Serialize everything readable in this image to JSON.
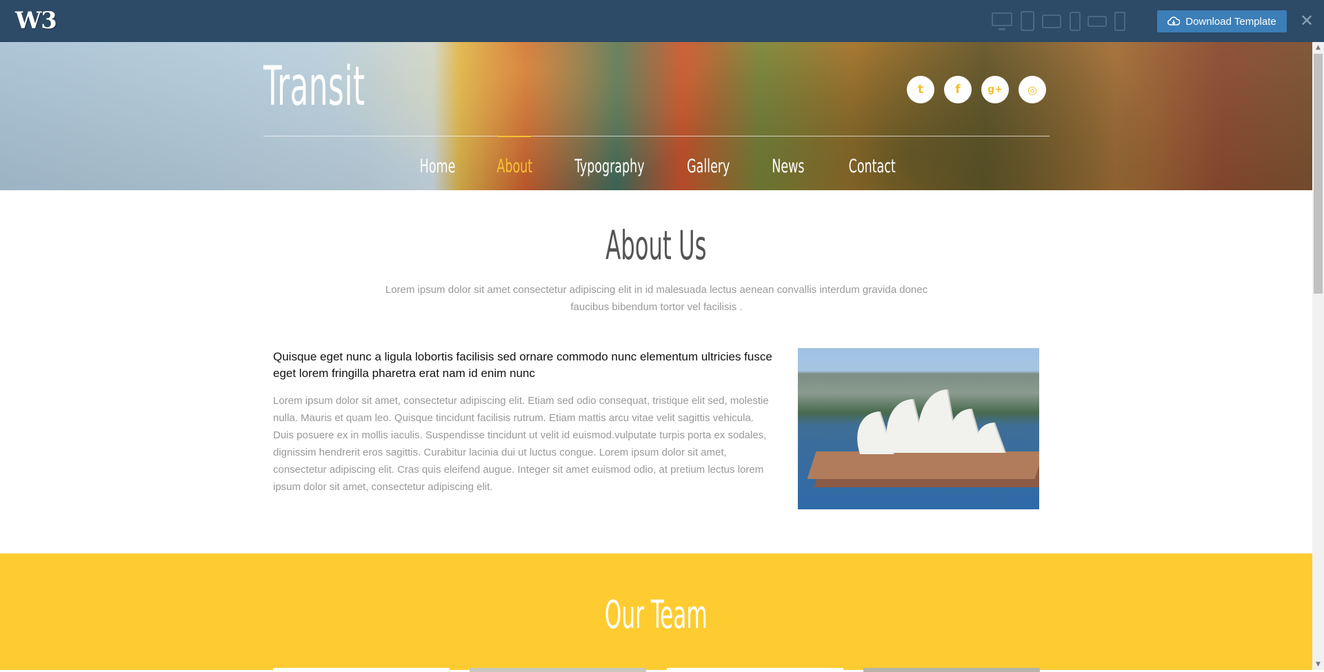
{
  "topbar": {
    "logo": "W3",
    "download_label": "Download Template",
    "close_label": "✕",
    "devices": [
      "desktop-icon",
      "tablet-portrait-icon",
      "tablet-landscape-icon",
      "phone-portrait-icon",
      "phone-landscape-icon",
      "mobile-icon"
    ]
  },
  "hero": {
    "title": "Transit",
    "social": [
      {
        "name": "twitter-icon",
        "glyph": "t"
      },
      {
        "name": "facebook-icon",
        "glyph": "f"
      },
      {
        "name": "google-plus-icon",
        "glyph": "g+"
      },
      {
        "name": "dribbble-icon",
        "glyph": "◎"
      }
    ],
    "nav": [
      {
        "label": "Home"
      },
      {
        "label": "About"
      },
      {
        "label": "Typography"
      },
      {
        "label": "Gallery"
      },
      {
        "label": "News"
      },
      {
        "label": "Contact"
      }
    ],
    "active_nav": "About"
  },
  "about": {
    "title": "About Us",
    "subtitle": "Lorem ipsum dolor sit amet consectetur adipiscing elit in id malesuada lectus aenean convallis interdum gravida donec faucibus bibendum tortor vel facilisis .",
    "lead": "Quisque eget nunc a ligula lobortis facilisis sed ornare commodo nunc elementum ultricies fusce eget lorem fringilla pharetra erat nam id enim nunc",
    "body": "Lorem ipsum dolor sit amet, consectetur adipiscing elit. Etiam sed odio consequat, tristique elit sed, molestie nulla. Mauris et quam leo. Quisque tincidunt facilisis rutrum. Etiam mattis arcu vitae velit sagittis vehicula. Duis posuere ex in mollis iaculis. Suspendisse tincidunt ut velit id euismod.vulputate turpis porta ex sodales, dignissim hendrerit eros sagittis. Curabitur lacinia dui ut luctus congue. Lorem ipsum dolor sit amet, consectetur adipiscing elit. Cras quis eleifend augue. Integer sit amet euismod odio, at pretium lectus lorem ipsum dolor sit amet, consectetur adipiscing elit."
  },
  "team": {
    "title": "Our Team"
  },
  "colors": {
    "topbar": "#2d4a66",
    "download_button": "#3c7eb8",
    "accent": "#f7c230",
    "team_bg": "#fecc30"
  }
}
